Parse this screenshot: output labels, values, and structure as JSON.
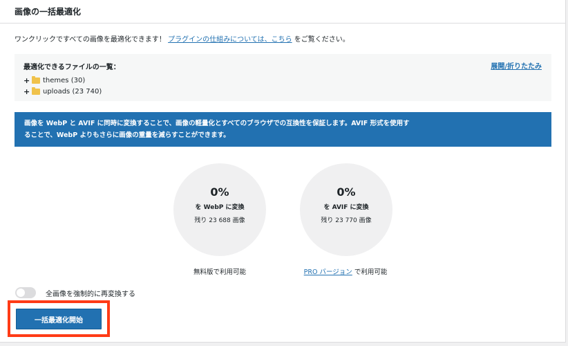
{
  "header": {
    "title": "画像の一括最適化"
  },
  "intro": {
    "text_before": "ワンクリックですべての画像を最適化できます！ ",
    "link": "プラグインの仕組みについては、こちら",
    "text_after": " をご覧ください。"
  },
  "files": {
    "heading": "最適化できるファイルの一覧：",
    "toggle_label": "展開/折りたたみ",
    "items": [
      {
        "expander": "+",
        "icon": "folder-icon",
        "name": "themes (30)"
      },
      {
        "expander": "+",
        "icon": "folder-icon",
        "name": "uploads (23 740)"
      }
    ]
  },
  "info": {
    "line1": "画像を WebP と AVIF に同時に変換することで、画像の軽量化とすべてのブラウザでの互換性を保証します。AVIF 形式を使用す",
    "line2": "ることで、WebP よりもさらに画像の重量を減らすことができます。"
  },
  "stats": {
    "webp": {
      "percent": "0%",
      "label": "を WebP に変換",
      "remaining": "残り 23 688 画像",
      "availability": "無料版で利用可能"
    },
    "avif": {
      "percent": "0%",
      "label": "を AVIF に変換",
      "remaining": "残り 23 770 画像",
      "availability_link": "PRO バージョン",
      "availability_suffix": " で利用可能"
    }
  },
  "force_reconvert": {
    "label": "全画像を強制的に再変換する",
    "enabled": false
  },
  "actions": {
    "start_label": "一括最適化開始",
    "highlight_color": "#ff3b16"
  },
  "colors": {
    "accent": "#2271b1",
    "circle_bg": "#f0f0f1",
    "folder": "#f0c24b"
  }
}
